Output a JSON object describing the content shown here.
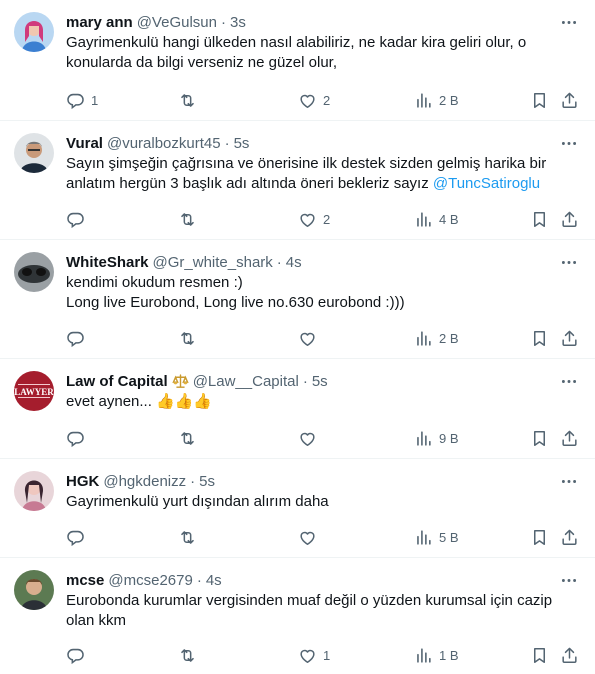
{
  "tweets": [
    {
      "name": "mary ann",
      "handle": "@VeGulsun",
      "dot": "·",
      "time": "3s",
      "lines": [
        "Gayrimenkulü hangi ülkeden nasıl alabiliriz, ne kadar kira geliri olur, o",
        "konularda da bilgi verseniz ne güzel olur,"
      ],
      "replies": "1",
      "likes": "2",
      "views": "2 B"
    },
    {
      "name": "Vural",
      "handle": "@vuralbozkurt45",
      "dot": "·",
      "time": "5s",
      "line1": "Sayın şimşeğin çağrısına ve önerisine ilk destek sizden gelmiş harika bir",
      "line2_prefix": "anlatım hergün 3 başlık adı altında öneri bekleriz sayız ",
      "mention": "@TuncSatiroglu",
      "replies": "",
      "likes": "2",
      "views": "4 B"
    },
    {
      "name": "WhiteShark",
      "handle": "@Gr_white_shark",
      "dot": "·",
      "time": "4s",
      "lines": [
        "kendimi okudum resmen :)",
        "Long live Eurobond, Long live no.630 eurobond :)))"
      ],
      "replies": "",
      "likes": "",
      "views": "2 B"
    },
    {
      "name": "Law of Capital",
      "handle": "@Law__Capital",
      "dot": "·",
      "time": "5s",
      "text": "evet aynen...",
      "emoji": "👍👍👍",
      "avatar_text": "LAWYER",
      "replies": "",
      "likes": "",
      "views": "9 B"
    },
    {
      "name": "HGK",
      "handle": "@hgkdenizz",
      "dot": "·",
      "time": "5s",
      "lines": [
        "Gayrimenkulü yurt dışından alırım daha"
      ],
      "replies": "",
      "likes": "",
      "views": "5 B"
    },
    {
      "name": "mcse",
      "handle": "@mcse2679",
      "dot": "·",
      "time": "4s",
      "lines": [
        "Eurobonda kurumlar vergisinden muaf değil o yüzden kurumsal için cazip",
        "olan kkm"
      ],
      "replies": "",
      "likes": "1",
      "views": "1 B"
    }
  ],
  "icons": {
    "more": "more-horizontal-icon",
    "reply": "reply-icon",
    "retweet": "retweet-icon",
    "like": "heart-icon",
    "views": "views-chart-icon",
    "bookmark": "bookmark-icon",
    "share": "share-icon",
    "badge": "scales-icon"
  },
  "colors": {
    "text": "#0f1419",
    "muted": "#536471",
    "link": "#1d9bf0",
    "divider": "#eff3f4"
  }
}
